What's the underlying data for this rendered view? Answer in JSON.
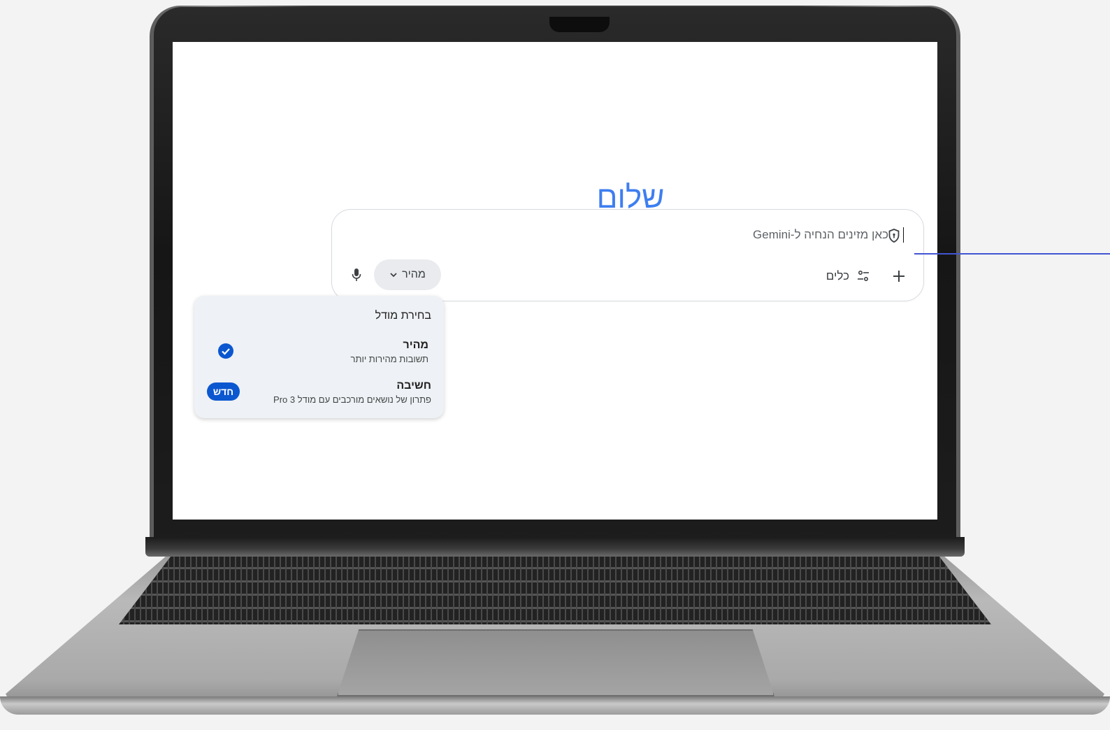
{
  "greeting": "שלום",
  "prompt": {
    "text": "כאן מזינים הנחיה ל-Gemini",
    "tools_label": "כלים",
    "model_label": "מהיר"
  },
  "model_menu": {
    "title": "בחירת מודל",
    "options": [
      {
        "name": "מהיר",
        "description": "תשובות מהירות יותר",
        "selected": true
      },
      {
        "name": "חשיבה",
        "description": "פתרון של נושאים מורכבים עם מודל 3 Pro",
        "badge": "חדש"
      }
    ]
  },
  "icons": {
    "shield": "shield-icon",
    "plus": "plus-icon",
    "tools": "tools-icon",
    "chevron": "chevron-down-icon",
    "mic": "mic-icon",
    "check": "check-circle-icon"
  },
  "colors": {
    "greeting": "#3e7ef0",
    "accent": "#0b57d0",
    "connector": "#4255d4"
  }
}
